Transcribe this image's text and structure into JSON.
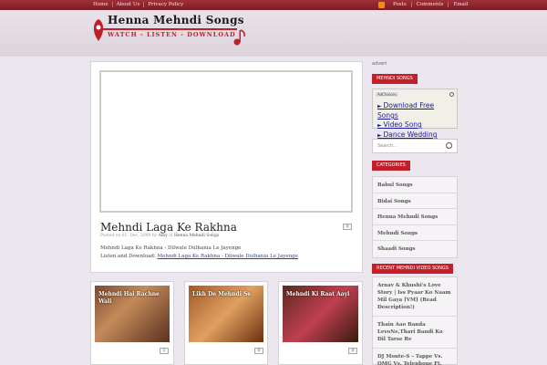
{
  "topnav": {
    "links": [
      "Home",
      "About Us",
      "Privacy Policy"
    ]
  },
  "rightnav": {
    "links": [
      "Posts",
      "Comments",
      "Email"
    ]
  },
  "logo": {
    "title": "Henna Mehndi Songs",
    "subtitle": "WATCH - LISTEN - DOWNLOAD"
  },
  "post": {
    "title": "Mehndi Laga Ke Rakhna",
    "comments": "0",
    "meta_prefix": "Posted on 01. Dec, 2009 by",
    "author": "Amy",
    "meta_in": "in",
    "category": "Henna Mehndi Songs",
    "line1": "Mehndi Laga Ke Rakhna - Dilwale Dulhania Le Jayenge",
    "line2_prefix": "Listen and Download:",
    "line2_link": "Mehndi Laga Ke Rakhna - Dilwale Dulhania Le Jayenge"
  },
  "thumbs": [
    {
      "label": "Mehndi Hai Rachne Wali",
      "comments": "1"
    },
    {
      "label": "Likh De Mehndi Se",
      "comments": "0"
    },
    {
      "label": "Mehndi Ki Raat Aayi",
      "comments": "0"
    }
  ],
  "sidebar": {
    "advert": "advert",
    "mehndi_songs_title": "Mehndi Songs",
    "adchoices": "AdChoices",
    "ad_links": [
      "Download Free Songs",
      "Video Song",
      "Dance Wedding"
    ],
    "search_placeholder": "Search...",
    "categories_title": "Categories",
    "categories": [
      "Babul Songs",
      "Bidai Songs",
      "Henna Mehndi Songs",
      "Mehndi Songs",
      "Shaadi Songs"
    ],
    "recent_title": "Recent Mehndi Video Songs",
    "recent": [
      "Arnav & Khushi's Love Story | Iss Pyaar Ko Naam Mil Gaya [VM] (Read Description!)",
      "Thain Aao Banda LevoNe,Thari Bandi Ko Dil Tarse Re",
      "DJ Monte-S – Tappe Vs. OMG Vs. Telephone Ft."
    ]
  }
}
